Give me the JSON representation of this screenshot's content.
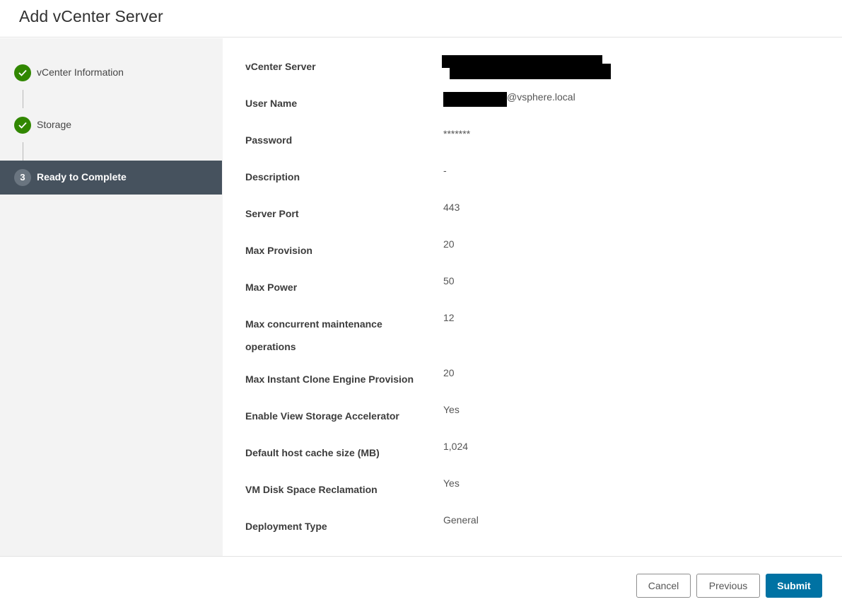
{
  "dialog": {
    "title": "Add vCenter Server"
  },
  "wizard": {
    "steps": [
      {
        "label": "vCenter Information",
        "status": "complete"
      },
      {
        "label": "Storage",
        "status": "complete"
      },
      {
        "label": "Ready to Complete",
        "status": "active",
        "number": "3"
      }
    ]
  },
  "summary": {
    "rows": [
      {
        "label": "vCenter Server",
        "value": ""
      },
      {
        "label": "User Name",
        "value": "@vsphere.local"
      },
      {
        "label": "Password",
        "value": "*******"
      },
      {
        "label": "Description",
        "value": "-"
      },
      {
        "label": "Server Port",
        "value": "443"
      },
      {
        "label": "Max Provision",
        "value": "20"
      },
      {
        "label": "Max Power",
        "value": "50"
      },
      {
        "label": "Max concurrent maintenance operations",
        "value": "12"
      },
      {
        "label": "Max Instant Clone Engine Provision",
        "value": "20"
      },
      {
        "label": "Enable View Storage Accelerator",
        "value": "Yes"
      },
      {
        "label": "Default host cache size (MB)",
        "value": "1,024"
      },
      {
        "label": "VM Disk Space Reclamation",
        "value": "Yes"
      },
      {
        "label": "Deployment Type",
        "value": "General"
      }
    ]
  },
  "footer": {
    "cancel_label": "Cancel",
    "previous_label": "Previous",
    "submit_label": "Submit"
  },
  "colors": {
    "complete_green": "#318700",
    "active_step_bg": "#46525e",
    "primary_button": "#0072a3"
  },
  "icons": {
    "complete_step": "check-circle-icon"
  }
}
